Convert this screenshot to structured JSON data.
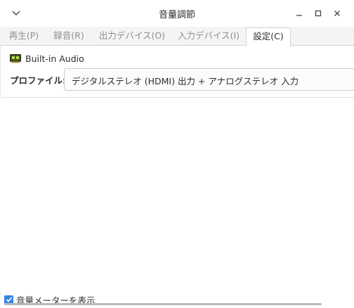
{
  "window": {
    "title": "音量調節"
  },
  "tabs": [
    {
      "label": "再生(P)",
      "active": false
    },
    {
      "label": "録音(R)",
      "active": false
    },
    {
      "label": "出力デバイス(O)",
      "active": false
    },
    {
      "label": "入力デバイス(I)",
      "active": false
    },
    {
      "label": "設定(C)",
      "active": true
    }
  ],
  "device": {
    "name": "Built-in Audio",
    "icon": "sound-card-icon"
  },
  "profile": {
    "label": "プロファイル:",
    "value": "デジタルステレオ (HDMI) 出力 + アナログステレオ 入力"
  },
  "footer": {
    "show_meters_label": "音量メーターを表示",
    "show_meters_checked": true
  },
  "colors": {
    "accent": "#3584e4"
  }
}
